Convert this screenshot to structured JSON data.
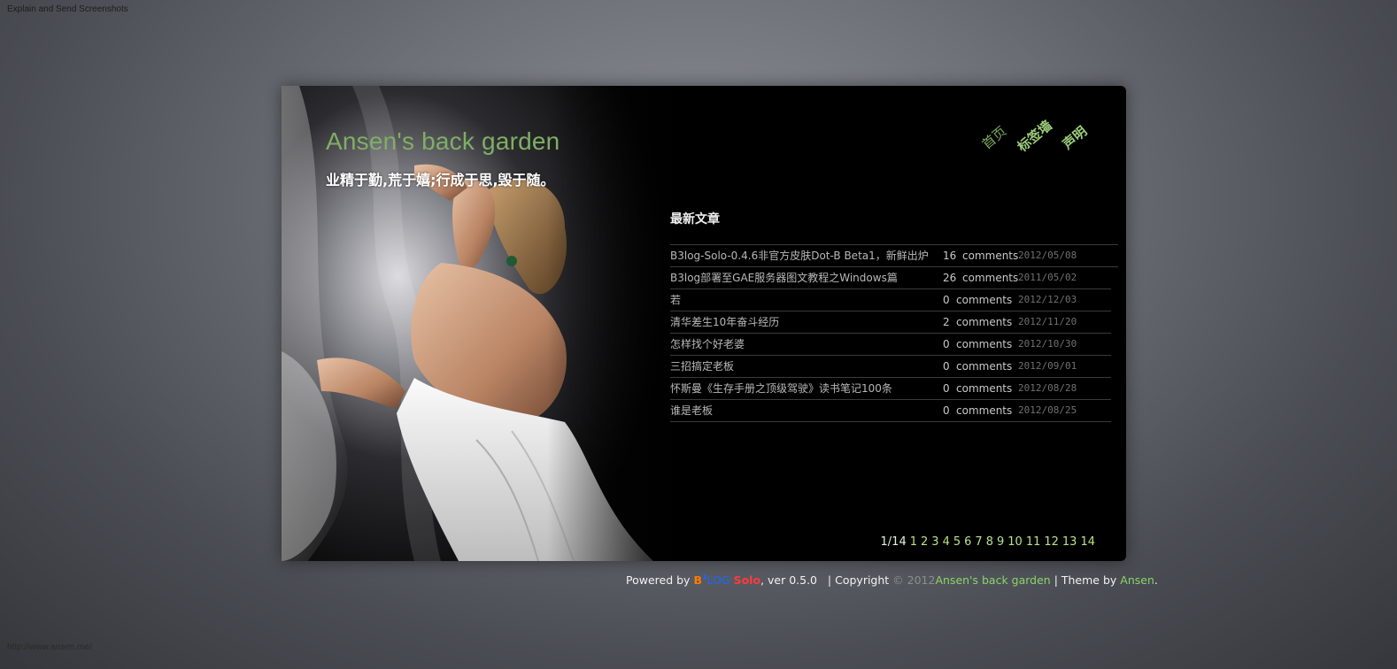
{
  "window": {
    "top_note": "Explain and Send Screenshots",
    "status_url": "http://www.ansen.me/"
  },
  "site": {
    "title": "Ansen's back garden",
    "subtitle": "业精于勤,荒于嬉;行成于思,毁于随。"
  },
  "nav": {
    "home": "首页",
    "tags": "标签墙",
    "about": "声明"
  },
  "latest": {
    "heading": "最新文章",
    "comments_label": "comments",
    "articles": [
      {
        "title": "B3log-Solo-0.4.6非官方皮肤Dot-B Beta1，新鲜出炉",
        "count": "16",
        "date": "2012/05/08"
      },
      {
        "title": "B3log部署至GAE服务器图文教程之Windows篇",
        "count": "26",
        "date": "2011/05/02"
      },
      {
        "title": "若",
        "count": "0",
        "date": "2012/12/03"
      },
      {
        "title": "清华差生10年奋斗经历",
        "count": "2",
        "date": "2012/11/20"
      },
      {
        "title": "怎样找个好老婆",
        "count": "0",
        "date": "2012/10/30"
      },
      {
        "title": "三招搞定老板",
        "count": "0",
        "date": "2012/09/01"
      },
      {
        "title": "怀斯曼《生存手册之顶级驾驶》读书笔记100条",
        "count": "0",
        "date": "2012/08/28"
      },
      {
        "title": "谁是老板",
        "count": "0",
        "date": "2012/08/25"
      }
    ]
  },
  "pager": {
    "current": "1/14",
    "pages": [
      "1",
      "2",
      "3",
      "4",
      "5",
      "6",
      "7",
      "8",
      "9",
      "10",
      "11",
      "12",
      "13",
      "14"
    ]
  },
  "footer": {
    "powered_by": "Powered by ",
    "b3": "B",
    "b3_sup": "3",
    "lo": "LOG",
    "solo": "Solo",
    "version": ", ver 0.5.0",
    "copyright_sep": "   | Copyright ",
    "copy_year": "© 2012",
    "site_link": "Ansen's back garden",
    "theme_by": " | Theme by ",
    "author": "Ansen",
    "end": "."
  },
  "colors": {
    "accent_green": "#7fae64",
    "frame_bg": "#000000",
    "page_bg": "#6e7178"
  }
}
